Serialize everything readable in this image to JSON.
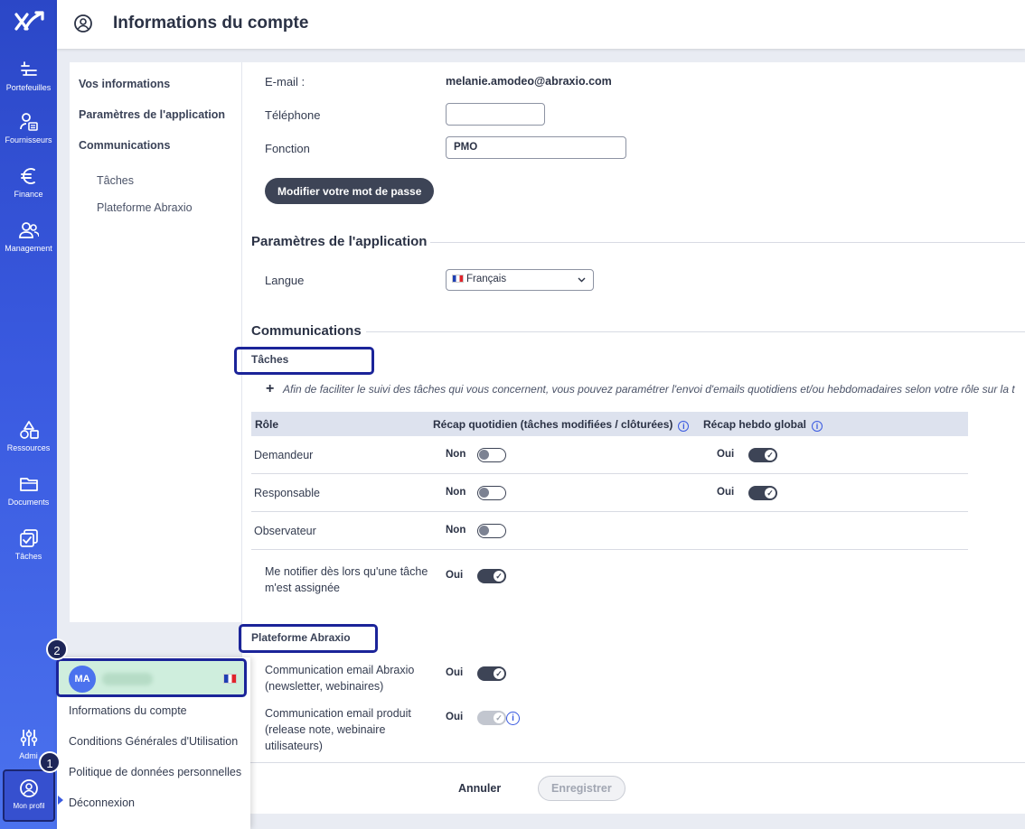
{
  "rail": {
    "items": [
      {
        "label": "Portefeuilles",
        "icon": "portfolio-icon"
      },
      {
        "label": "Fournisseurs",
        "icon": "suppliers-icon"
      },
      {
        "label": "Finance",
        "icon": "euro-icon"
      },
      {
        "label": "Management",
        "icon": "users-icon"
      },
      {
        "label": "Ressources",
        "icon": "shapes-icon"
      },
      {
        "label": "Documents",
        "icon": "folder-icon"
      },
      {
        "label": "Tâches",
        "icon": "tasks-icon"
      },
      {
        "label": "Admi",
        "icon": "sliders-icon"
      },
      {
        "label": "Mon profil",
        "icon": "profile-icon"
      }
    ]
  },
  "header": {
    "title": "Informations du compte",
    "icon": "user-circle-icon"
  },
  "subnav": {
    "items": [
      "Vos informations",
      "Paramètres de l'application",
      "Communications"
    ],
    "subitems": [
      "Tâches",
      "Plateforme Abraxio"
    ]
  },
  "account": {
    "email_label": "E-mail :",
    "email_value": "melanie.amodeo@abraxio.com",
    "phone_label": "Téléphone",
    "phone_value": "",
    "function_label": "Fonction",
    "function_value": "PMO",
    "password_button": "Modifier votre mot de passe"
  },
  "app_settings": {
    "title": "Paramètres de l'application",
    "language_label": "Langue",
    "language_value": "Français"
  },
  "communications": {
    "title": "Communications",
    "tasks_title": "Tâches",
    "tasks_note": "Afin de faciliter le suivi des tâches qui vous concernent, vous pouvez paramétrer l'envoi d'emails quotidiens et/ou hebdomadaires selon votre rôle sur la t",
    "columns": [
      "Rôle",
      "Récap quotidien (tâches modifiées / clôturées)",
      "Récap hebdo global"
    ],
    "rows": [
      {
        "role": "Demandeur",
        "daily_label": "Non",
        "daily_on": false,
        "weekly_label": "Oui",
        "weekly_on": true
      },
      {
        "role": "Responsable",
        "daily_label": "Non",
        "daily_on": false,
        "weekly_label": "Oui",
        "weekly_on": true
      },
      {
        "role": "Observateur",
        "daily_label": "Non",
        "daily_on": false
      }
    ],
    "notify_label_1": "Me notifier dès lors qu'une tâche",
    "notify_label_2": "m'est assignée",
    "notify_value": "Oui",
    "platform_title": "Plateforme Abraxio",
    "comm1_line1": "Communication email Abraxio",
    "comm1_line2": "(newsletter, webinaires)",
    "comm1_value": "Oui",
    "comm2_line1": "Communication email produit",
    "comm2_line2": "(release note, webinaire",
    "comm2_line3": "utilisateurs)",
    "comm2_value": "Oui"
  },
  "footer": {
    "cancel": "Annuler",
    "save": "Enregistrer"
  },
  "profile_popup": {
    "initials": "MA",
    "items": [
      "Informations du compte",
      "Conditions Générales d'Utilisation",
      "Politique de données personnelles",
      "Déconnexion"
    ]
  },
  "badges": {
    "one": "1",
    "two": "2"
  },
  "colors": {
    "rail": "#3a5ae0",
    "accent": "#1b2499",
    "toggle": "#3d4456",
    "highlight": "#cfeedd"
  }
}
